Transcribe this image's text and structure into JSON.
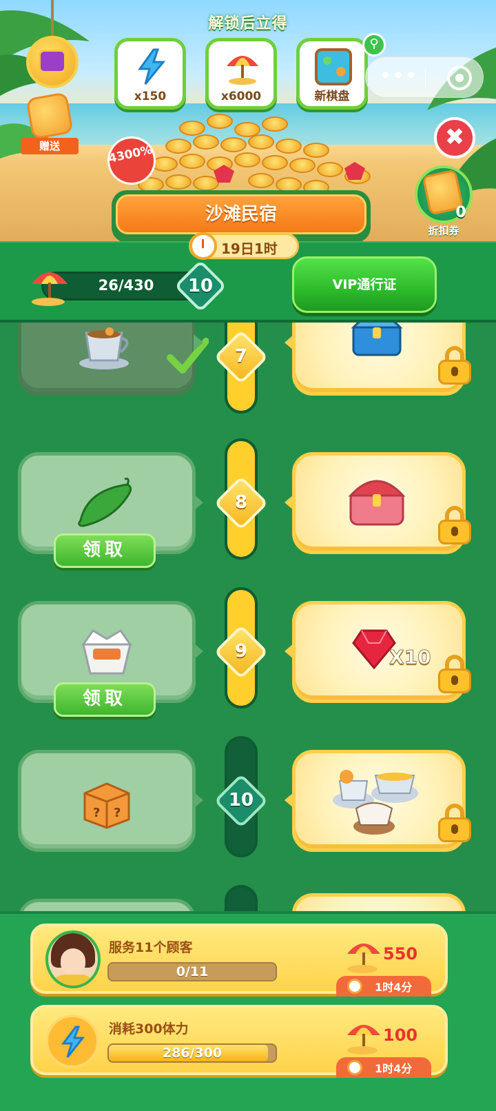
{
  "header": {
    "unlock_title": "解锁后立得",
    "gift_label": "赠送",
    "bonus_badge": "4300%",
    "rewards": [
      {
        "label": "x150",
        "icon": "energy-bolt-icon"
      },
      {
        "label": "x6000",
        "icon": "beach-umbrella-icon"
      },
      {
        "label": "新棋盘",
        "icon": "new-board-icon"
      }
    ],
    "discount": {
      "count": "0",
      "label": "折扣券"
    }
  },
  "event": {
    "title": "沙滩民宿",
    "timer": "19日1时"
  },
  "progress": {
    "xp": "26/430",
    "xp_fraction": 0.06,
    "level": "10",
    "vip_button": "VIP通行证"
  },
  "rows": [
    {
      "level": "7",
      "free_item": "tea-cup-icon",
      "free_claimed": true,
      "vip_item": "blue-chest-icon",
      "vip_locked": true
    },
    {
      "level": "8",
      "free_item": "cucumber-icon",
      "claim_label": "领取",
      "vip_item": "red-chest-icon",
      "vip_locked": true
    },
    {
      "level": "9",
      "free_item": "takeout-box-icon",
      "claim_label": "领取",
      "vip_item": "ruby-gem-icon",
      "vip_count": "X10",
      "vip_locked": true
    },
    {
      "level": "10",
      "free_item": "mystery-box-icon",
      "vip_item": "food-set-icon",
      "vip_locked": true
    }
  ],
  "tasks": [
    {
      "title": "服务11个顾客",
      "progress": "0/11",
      "fraction": 0,
      "reward": "550",
      "timer": "1时4分"
    },
    {
      "title": "消耗300体力",
      "progress": "286/300",
      "fraction": 0.953,
      "reward": "100",
      "timer": "1时4分"
    }
  ],
  "colors": {
    "background": "#1f8d48",
    "vip_button": "#2dbb2b",
    "track_filled": "#ffcf2c",
    "task_card": "#ffd34a"
  }
}
